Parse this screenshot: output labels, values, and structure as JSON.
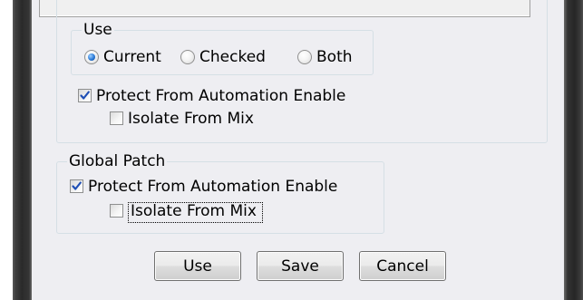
{
  "use_group": {
    "legend": "Use",
    "options": [
      {
        "label": "Current",
        "selected": true
      },
      {
        "label": "Checked",
        "selected": false
      },
      {
        "label": "Both",
        "selected": false
      }
    ]
  },
  "local_options": {
    "protect_label": "Protect From Automation Enable",
    "protect_checked": true,
    "isolate_label": "Isolate From Mix",
    "isolate_checked": false
  },
  "global_patch": {
    "legend": "Global Patch",
    "protect_label": "Protect From Automation Enable",
    "protect_checked": true,
    "isolate_label": "Isolate From Mix",
    "isolate_checked": false
  },
  "buttons": {
    "use_label": "Use",
    "save_label": "Save",
    "cancel_label": "Cancel"
  },
  "colors": {
    "window_frame": "#2a2a2a",
    "dialog_background": "#eeeef2",
    "group_border": "#d5dfe5",
    "radio_selected": "#2a7ad8",
    "check_mark": "#1f4fb5"
  }
}
